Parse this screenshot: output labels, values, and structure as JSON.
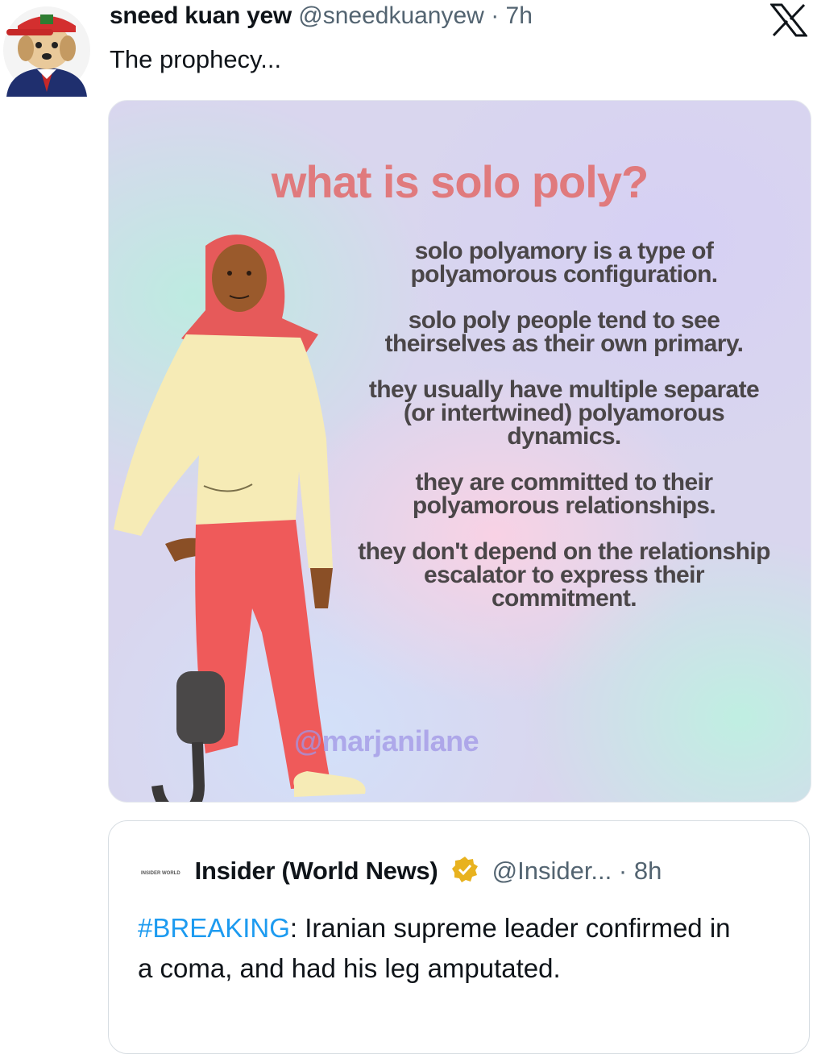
{
  "tweet": {
    "display_name": "sneed kuan yew",
    "handle": "@sneedkuanyew",
    "separator": "·",
    "time": "7h",
    "text": "The prophecy...",
    "avatar_icon": "avatar-dog-in-cap-icon",
    "platform_icon": "x-logo-icon"
  },
  "media": {
    "title": "what is solo poly?",
    "paragraphs": [
      "solo polyamory is a type of polyamorous configuration.",
      "solo poly people tend to see theirselves as their own primary.",
      "they usually have multiple separate (or intertwined) polyamorous dynamics.",
      "they are committed to their polyamorous relationships.",
      "they don't depend on the relationship escalator to express their commitment."
    ],
    "watermark": "@marjanilane",
    "colors": {
      "title": "#e07a7d",
      "body_text": "#4a4648"
    }
  },
  "quoted_tweet": {
    "logo_text": "INSIDER WORLD",
    "display_name": "Insider (World News)",
    "verified_icon": "gold-verified-badge-icon",
    "handle": "@Insider...",
    "separator": "·",
    "time": "8h",
    "hashtag": "#BREAKING",
    "text": ": Iranian supreme leader confirmed in a coma, and had his leg amputated.",
    "colors": {
      "hashtag": "#1d9bf0",
      "badge": "#e8b21f"
    }
  }
}
